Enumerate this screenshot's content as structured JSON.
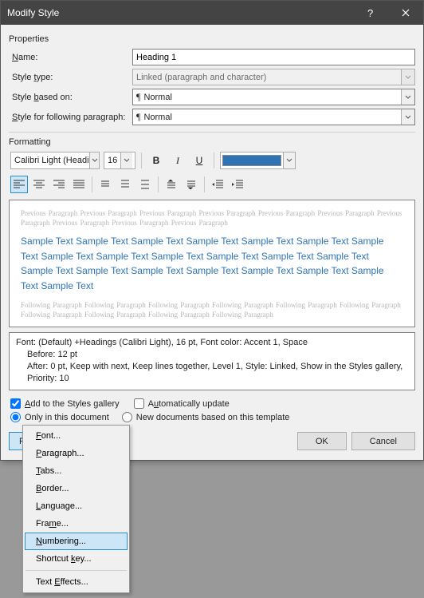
{
  "titlebar": {
    "title": "Modify Style"
  },
  "properties": {
    "group_label": "Properties",
    "name_label": "Name:",
    "name_value": "Heading 1",
    "type_label": "Style type:",
    "type_value": "Linked (paragraph and character)",
    "based_label": "Style based on:",
    "based_value": "Normal",
    "following_label": "Style for following paragraph:",
    "following_value": "Normal"
  },
  "formatting": {
    "group_label": "Formatting",
    "font_name": "Calibri Light (Headings)",
    "font_size": "16",
    "bold": "B",
    "italic": "I",
    "underline": "U",
    "color": "#2e74b5"
  },
  "preview": {
    "prev_para": "Previous Paragraph Previous Paragraph Previous Paragraph Previous Paragraph Previous Paragraph Previous Paragraph Previous Paragraph Previous Paragraph Previous Paragraph Previous Paragraph",
    "sample": "Sample Text Sample Text Sample Text Sample Text Sample Text Sample Text Sample Text Sample Text Sample Text Sample Text Sample Text Sample Text Sample Text Sample Text Sample Text Sample Text Sample Text Sample Text Sample Text Sample Text Sample Text",
    "foll_para": "Following Paragraph Following Paragraph Following Paragraph Following Paragraph Following Paragraph Following Paragraph Following Paragraph Following Paragraph Following Paragraph Following Paragraph"
  },
  "description": {
    "line1": "Font: (Default) +Headings (Calibri Light), 16 pt, Font color: Accent 1, Space",
    "line2": "Before:  12 pt",
    "line3": "After:  0 pt, Keep with next, Keep lines together, Level 1, Style: Linked, Show in the Styles gallery, Priority: 10"
  },
  "options": {
    "add_gallery": "Add to the Styles gallery",
    "auto_update": "Automatically update",
    "only_doc": "Only in this document",
    "new_template": "New documents based on this template"
  },
  "buttons": {
    "format": "Format",
    "ok": "OK",
    "cancel": "Cancel"
  },
  "format_menu": {
    "font": "Font...",
    "paragraph": "Paragraph...",
    "tabs": "Tabs...",
    "border": "Border...",
    "language": "Language...",
    "frame": "Frame...",
    "numbering": "Numbering...",
    "shortcut": "Shortcut key...",
    "texteffects": "Text Effects..."
  }
}
